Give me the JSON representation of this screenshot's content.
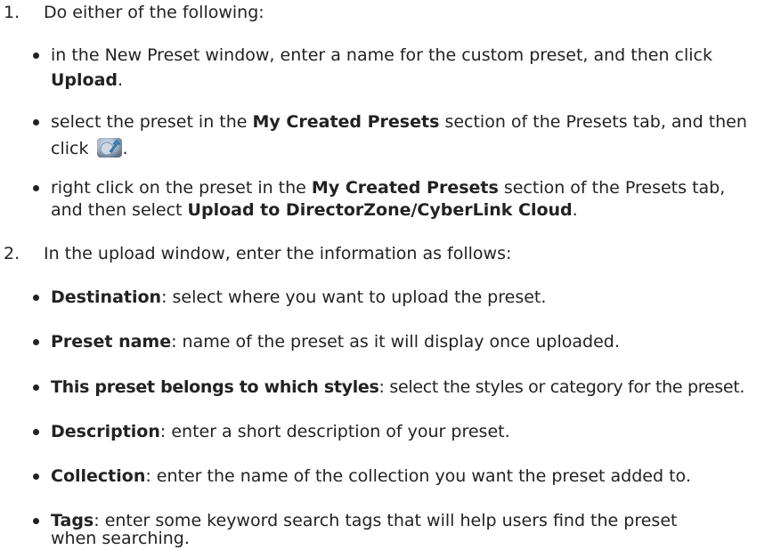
{
  "steps": [
    {
      "number": "1.",
      "text": "Do either of the following:",
      "options": [
        {
          "line1_pre": "in the New Preset window, enter a name for the custom preset, and then click",
          "line2_bold": "Upload",
          "line2_post": "."
        },
        {
          "line1_pre": "select the preset in the ",
          "line1_bold": "My Created Presets",
          "line1_post": " section of the Presets tab, and then",
          "line2_pre": "click ",
          "icon": "upload-preset-icon",
          "line2_post": "."
        },
        {
          "line1_pre": "right click on the preset in the ",
          "line1_bold": "My Created Presets",
          "line1_post": " section of the Presets tab,",
          "line2_pre": "and then select ",
          "line2_bold": "Upload to DirectorZone/CyberLink Cloud",
          "line2_post": "."
        }
      ]
    },
    {
      "number": "2.",
      "text": "In the upload window, enter the information as follows:",
      "fields": [
        {
          "term": "Destination",
          "desc": ": select where you want to upload the preset."
        },
        {
          "term": "Preset name",
          "desc": ": name of the preset as it will display once uploaded."
        },
        {
          "term": "This preset belongs to which styles",
          "desc": ": select the styles or category for the preset."
        },
        {
          "term": "Description",
          "desc": ": enter a short description of your preset."
        },
        {
          "term": "Collection",
          "desc": ": enter the name of the collection you want the preset added to."
        },
        {
          "term": "Tags",
          "desc": ": enter some keyword search tags that will help users find the preset",
          "desc2": "when searching."
        }
      ]
    }
  ]
}
